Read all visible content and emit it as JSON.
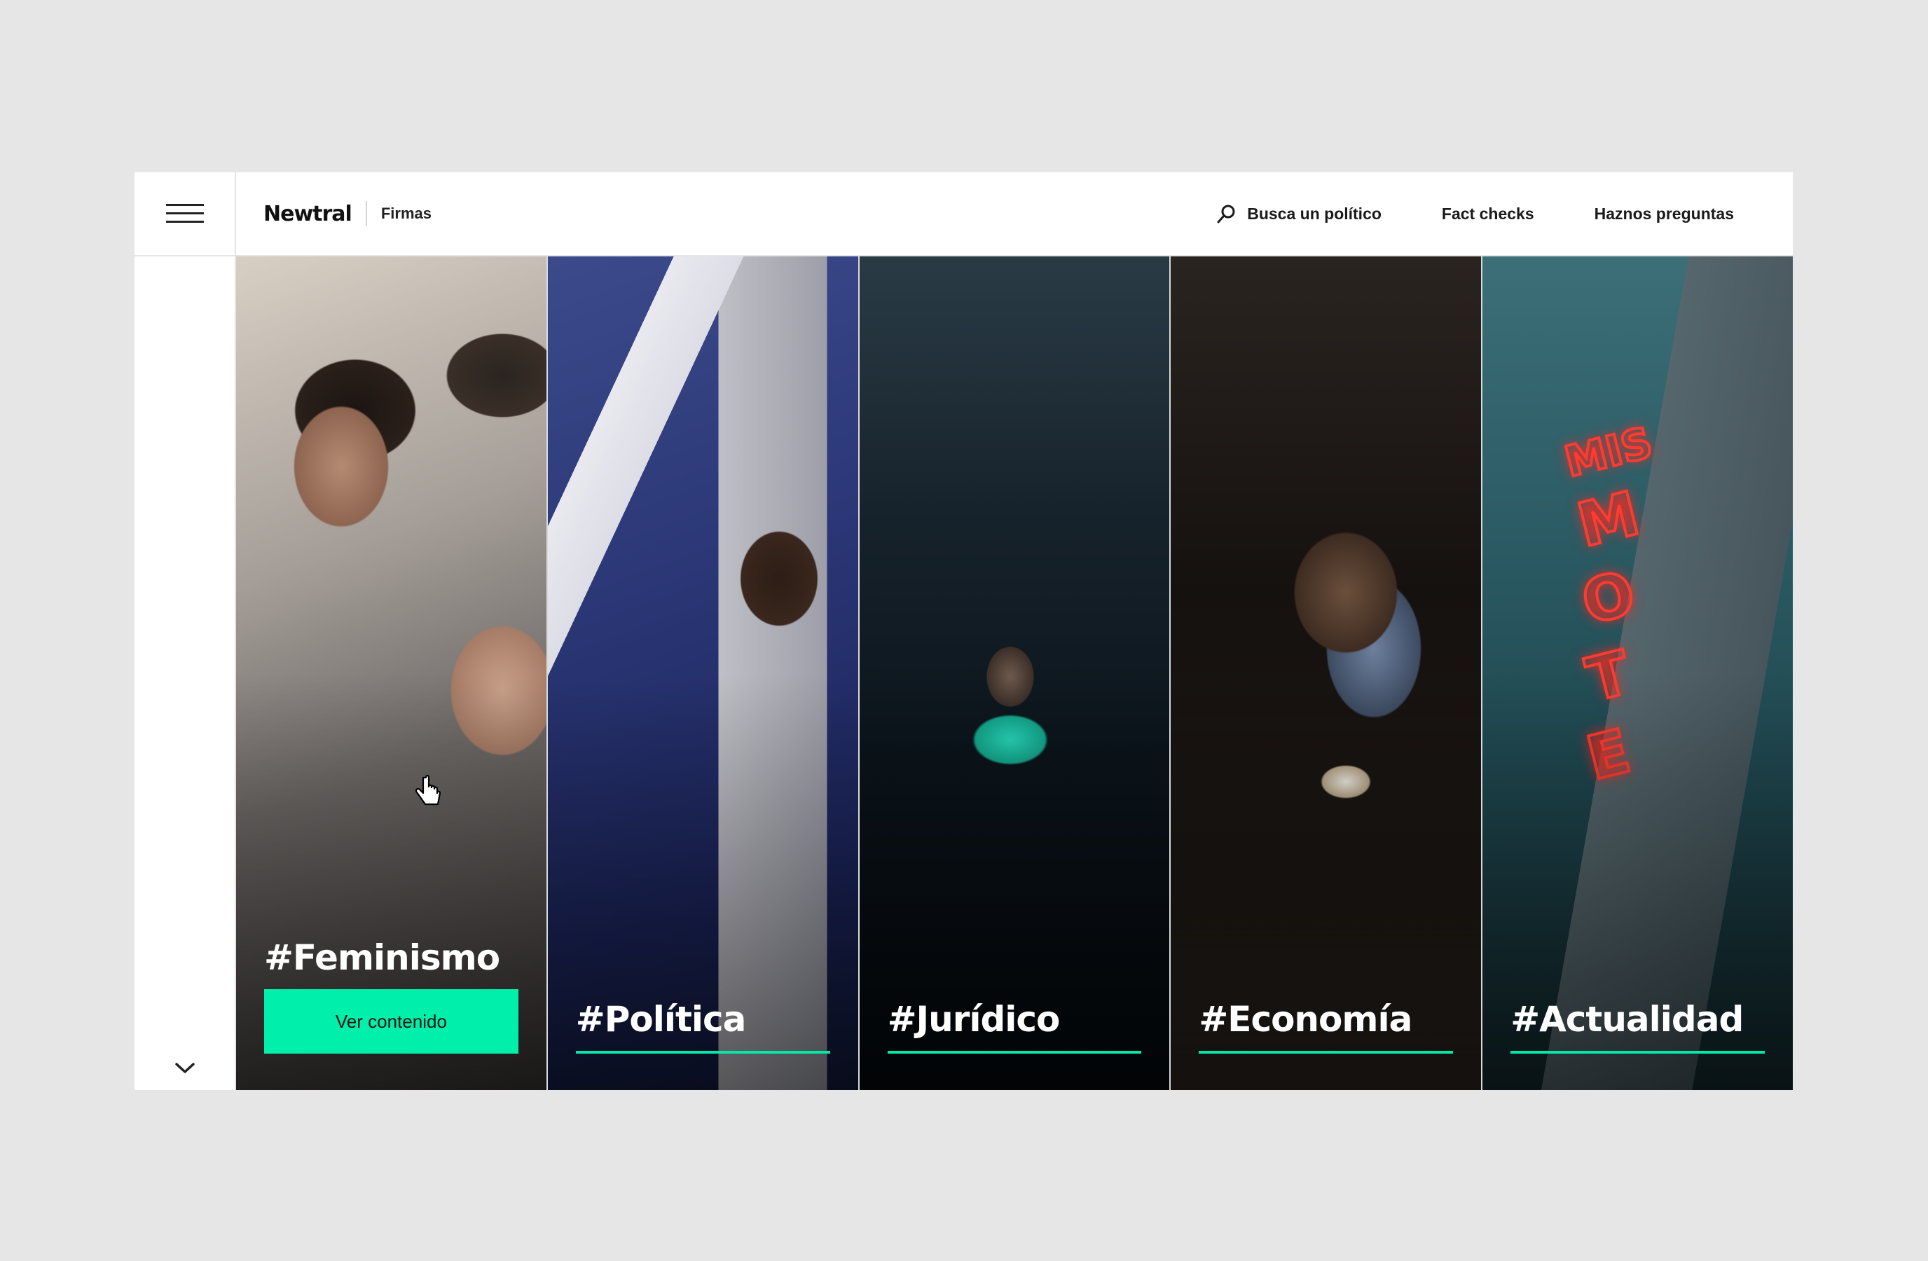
{
  "header": {
    "logo": "Newtral",
    "section": "Firmas",
    "nav": [
      {
        "label": "Busca un político",
        "icon": "search-icon"
      },
      {
        "label": "Fact checks"
      },
      {
        "label": "Haznos preguntas"
      }
    ]
  },
  "cards": [
    {
      "title": "#Feminismo",
      "cta": "Ver contenido"
    },
    {
      "title": "#Política"
    },
    {
      "title": "#Jurídico"
    },
    {
      "title": "#Economía"
    },
    {
      "title": "#Actualidad"
    }
  ],
  "colors": {
    "accent": "#00efaa",
    "background": "#e6e6e6",
    "text": "#111111"
  },
  "icons": [
    "menu-icon",
    "search-icon",
    "chevron-down-icon",
    "hand-pointer-icon"
  ]
}
